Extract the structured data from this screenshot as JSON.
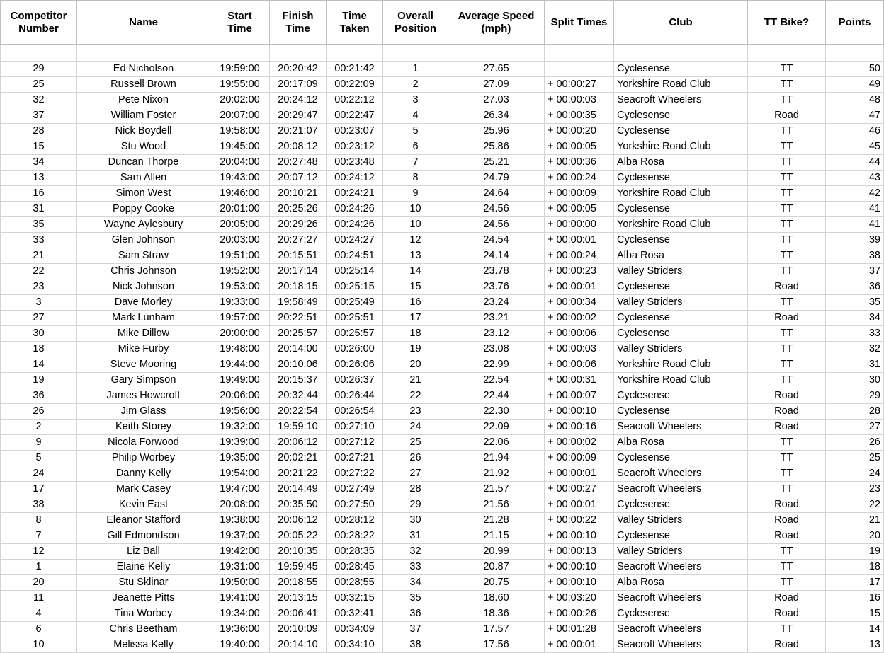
{
  "table": {
    "columns": [
      {
        "key": "number",
        "label": "Competitor Number"
      },
      {
        "key": "name",
        "label": "Name"
      },
      {
        "key": "start",
        "label": "Start Time"
      },
      {
        "key": "finish",
        "label": "Finish Time"
      },
      {
        "key": "taken",
        "label": "Time Taken"
      },
      {
        "key": "pos",
        "label": "Overall Position"
      },
      {
        "key": "speed",
        "label": "Average Speed (mph)"
      },
      {
        "key": "split",
        "label": "Split Times"
      },
      {
        "key": "club",
        "label": "Club"
      },
      {
        "key": "bike",
        "label": "TT Bike?"
      },
      {
        "key": "points",
        "label": "Points"
      }
    ],
    "header_lines": {
      "number": [
        "Competitor",
        "Number"
      ],
      "name": [
        "Name"
      ],
      "start": [
        "Start",
        "Time"
      ],
      "finish": [
        "Finish",
        "Time"
      ],
      "taken": [
        "Time",
        "Taken"
      ],
      "pos": [
        "Overall",
        "Position"
      ],
      "speed": [
        "Average Speed",
        "(mph)"
      ],
      "split": [
        "Split Times"
      ],
      "club": [
        "Club"
      ],
      "bike": [
        "TT Bike?"
      ],
      "points": [
        "Points"
      ]
    },
    "rows": [
      {
        "number": "29",
        "name": "Ed Nicholson",
        "start": "19:59:00",
        "finish": "20:20:42",
        "taken": "00:21:42",
        "pos": "1",
        "speed": "27.65",
        "split": "",
        "club": "Cyclesense",
        "bike": "TT",
        "points": "50"
      },
      {
        "number": "25",
        "name": "Russell Brown",
        "start": "19:55:00",
        "finish": "20:17:09",
        "taken": "00:22:09",
        "pos": "2",
        "speed": "27.09",
        "split": "+ 00:00:27",
        "club": "Yorkshire Road Club",
        "bike": "TT",
        "points": "49"
      },
      {
        "number": "32",
        "name": "Pete Nixon",
        "start": "20:02:00",
        "finish": "20:24:12",
        "taken": "00:22:12",
        "pos": "3",
        "speed": "27.03",
        "split": "+ 00:00:03",
        "club": "Seacroft Wheelers",
        "bike": "TT",
        "points": "48"
      },
      {
        "number": "37",
        "name": "William Foster",
        "start": "20:07:00",
        "finish": "20:29:47",
        "taken": "00:22:47",
        "pos": "4",
        "speed": "26.34",
        "split": "+ 00:00:35",
        "club": "Cyclesense",
        "bike": "Road",
        "points": "47"
      },
      {
        "number": "28",
        "name": "Nick Boydell",
        "start": "19:58:00",
        "finish": "20:21:07",
        "taken": "00:23:07",
        "pos": "5",
        "speed": "25.96",
        "split": "+ 00:00:20",
        "club": "Cyclesense",
        "bike": "TT",
        "points": "46"
      },
      {
        "number": "15",
        "name": "Stu Wood",
        "start": "19:45:00",
        "finish": "20:08:12",
        "taken": "00:23:12",
        "pos": "6",
        "speed": "25.86",
        "split": "+ 00:00:05",
        "club": "Yorkshire Road Club",
        "bike": "TT",
        "points": "45"
      },
      {
        "number": "34",
        "name": "Duncan Thorpe",
        "start": "20:04:00",
        "finish": "20:27:48",
        "taken": "00:23:48",
        "pos": "7",
        "speed": "25.21",
        "split": "+ 00:00:36",
        "club": "Alba Rosa",
        "bike": "TT",
        "points": "44"
      },
      {
        "number": "13",
        "name": "Sam Allen",
        "start": "19:43:00",
        "finish": "20:07:12",
        "taken": "00:24:12",
        "pos": "8",
        "speed": "24.79",
        "split": "+ 00:00:24",
        "club": "Cyclesense",
        "bike": "TT",
        "points": "43"
      },
      {
        "number": "16",
        "name": "Simon West",
        "start": "19:46:00",
        "finish": "20:10:21",
        "taken": "00:24:21",
        "pos": "9",
        "speed": "24.64",
        "split": "+ 00:00:09",
        "club": "Yorkshire Road Club",
        "bike": "TT",
        "points": "42"
      },
      {
        "number": "31",
        "name": "Poppy Cooke",
        "start": "20:01:00",
        "finish": "20:25:26",
        "taken": "00:24:26",
        "pos": "10",
        "speed": "24.56",
        "split": "+ 00:00:05",
        "club": "Cyclesense",
        "bike": "TT",
        "points": "41"
      },
      {
        "number": "35",
        "name": "Wayne Aylesbury",
        "start": "20:05:00",
        "finish": "20:29:26",
        "taken": "00:24:26",
        "pos": "10",
        "speed": "24.56",
        "split": "+ 00:00:00",
        "club": "Yorkshire Road Club",
        "bike": "TT",
        "points": "41"
      },
      {
        "number": "33",
        "name": "Glen Johnson",
        "start": "20:03:00",
        "finish": "20:27:27",
        "taken": "00:24:27",
        "pos": "12",
        "speed": "24.54",
        "split": "+ 00:00:01",
        "club": "Cyclesense",
        "bike": "TT",
        "points": "39"
      },
      {
        "number": "21",
        "name": "Sam Straw",
        "start": "19:51:00",
        "finish": "20:15:51",
        "taken": "00:24:51",
        "pos": "13",
        "speed": "24.14",
        "split": "+ 00:00:24",
        "club": "Alba Rosa",
        "bike": "TT",
        "points": "38"
      },
      {
        "number": "22",
        "name": "Chris Johnson",
        "start": "19:52:00",
        "finish": "20:17:14",
        "taken": "00:25:14",
        "pos": "14",
        "speed": "23.78",
        "split": "+ 00:00:23",
        "club": "Valley Striders",
        "bike": "TT",
        "points": "37"
      },
      {
        "number": "23",
        "name": "Nick Johnson",
        "start": "19:53:00",
        "finish": "20:18:15",
        "taken": "00:25:15",
        "pos": "15",
        "speed": "23.76",
        "split": "+ 00:00:01",
        "club": "Cyclesense",
        "bike": "Road",
        "points": "36"
      },
      {
        "number": "3",
        "name": "Dave Morley",
        "start": "19:33:00",
        "finish": "19:58:49",
        "taken": "00:25:49",
        "pos": "16",
        "speed": "23.24",
        "split": "+ 00:00:34",
        "club": "Valley Striders",
        "bike": "TT",
        "points": "35"
      },
      {
        "number": "27",
        "name": "Mark Lunham",
        "start": "19:57:00",
        "finish": "20:22:51",
        "taken": "00:25:51",
        "pos": "17",
        "speed": "23.21",
        "split": "+ 00:00:02",
        "club": "Cyclesense",
        "bike": "Road",
        "points": "34"
      },
      {
        "number": "30",
        "name": "Mike Dillow",
        "start": "20:00:00",
        "finish": "20:25:57",
        "taken": "00:25:57",
        "pos": "18",
        "speed": "23.12",
        "split": "+ 00:00:06",
        "club": "Cyclesense",
        "bike": "TT",
        "points": "33"
      },
      {
        "number": "18",
        "name": "Mike Furby",
        "start": "19:48:00",
        "finish": "20:14:00",
        "taken": "00:26:00",
        "pos": "19",
        "speed": "23.08",
        "split": "+ 00:00:03",
        "club": "Valley Striders",
        "bike": "TT",
        "points": "32"
      },
      {
        "number": "14",
        "name": "Steve Mooring",
        "start": "19:44:00",
        "finish": "20:10:06",
        "taken": "00:26:06",
        "pos": "20",
        "speed": "22.99",
        "split": "+ 00:00:06",
        "club": "Yorkshire Road Club",
        "bike": "TT",
        "points": "31"
      },
      {
        "number": "19",
        "name": "Gary Simpson",
        "start": "19:49:00",
        "finish": "20:15:37",
        "taken": "00:26:37",
        "pos": "21",
        "speed": "22.54",
        "split": "+ 00:00:31",
        "club": "Yorkshire Road Club",
        "bike": "TT",
        "points": "30"
      },
      {
        "number": "36",
        "name": "James Howcroft",
        "start": "20:06:00",
        "finish": "20:32:44",
        "taken": "00:26:44",
        "pos": "22",
        "speed": "22.44",
        "split": "+ 00:00:07",
        "club": "Cyclesense",
        "bike": "Road",
        "points": "29"
      },
      {
        "number": "26",
        "name": "Jim Glass",
        "start": "19:56:00",
        "finish": "20:22:54",
        "taken": "00:26:54",
        "pos": "23",
        "speed": "22.30",
        "split": "+ 00:00:10",
        "club": "Cyclesense",
        "bike": "Road",
        "points": "28"
      },
      {
        "number": "2",
        "name": "Keith Storey",
        "start": "19:32:00",
        "finish": "19:59:10",
        "taken": "00:27:10",
        "pos": "24",
        "speed": "22.09",
        "split": "+ 00:00:16",
        "club": "Seacroft Wheelers",
        "bike": "Road",
        "points": "27"
      },
      {
        "number": "9",
        "name": "Nicola Forwood",
        "start": "19:39:00",
        "finish": "20:06:12",
        "taken": "00:27:12",
        "pos": "25",
        "speed": "22.06",
        "split": "+ 00:00:02",
        "club": "Alba Rosa",
        "bike": "TT",
        "points": "26"
      },
      {
        "number": "5",
        "name": "Philip Worbey",
        "start": "19:35:00",
        "finish": "20:02:21",
        "taken": "00:27:21",
        "pos": "26",
        "speed": "21.94",
        "split": "+ 00:00:09",
        "club": "Cyclesense",
        "bike": "TT",
        "points": "25"
      },
      {
        "number": "24",
        "name": "Danny Kelly",
        "start": "19:54:00",
        "finish": "20:21:22",
        "taken": "00:27:22",
        "pos": "27",
        "speed": "21.92",
        "split": "+ 00:00:01",
        "club": "Seacroft Wheelers",
        "bike": "TT",
        "points": "24"
      },
      {
        "number": "17",
        "name": "Mark Casey",
        "start": "19:47:00",
        "finish": "20:14:49",
        "taken": "00:27:49",
        "pos": "28",
        "speed": "21.57",
        "split": "+ 00:00:27",
        "club": "Seacroft Wheelers",
        "bike": "TT",
        "points": "23"
      },
      {
        "number": "38",
        "name": "Kevin East",
        "start": "20:08:00",
        "finish": "20:35:50",
        "taken": "00:27:50",
        "pos": "29",
        "speed": "21.56",
        "split": "+ 00:00:01",
        "club": "Cyclesense",
        "bike": "Road",
        "points": "22"
      },
      {
        "number": "8",
        "name": "Eleanor Stafford",
        "start": "19:38:00",
        "finish": "20:06:12",
        "taken": "00:28:12",
        "pos": "30",
        "speed": "21.28",
        "split": "+ 00:00:22",
        "club": "Valley Striders",
        "bike": "Road",
        "points": "21"
      },
      {
        "number": "7",
        "name": "Gill Edmondson",
        "start": "19:37:00",
        "finish": "20:05:22",
        "taken": "00:28:22",
        "pos": "31",
        "speed": "21.15",
        "split": "+ 00:00:10",
        "club": "Cyclesense",
        "bike": "Road",
        "points": "20"
      },
      {
        "number": "12",
        "name": "Liz Ball",
        "start": "19:42:00",
        "finish": "20:10:35",
        "taken": "00:28:35",
        "pos": "32",
        "speed": "20.99",
        "split": "+ 00:00:13",
        "club": "Valley Striders",
        "bike": "TT",
        "points": "19"
      },
      {
        "number": "1",
        "name": "Elaine Kelly",
        "start": "19:31:00",
        "finish": "19:59:45",
        "taken": "00:28:45",
        "pos": "33",
        "speed": "20.87",
        "split": "+ 00:00:10",
        "club": "Seacroft Wheelers",
        "bike": "TT",
        "points": "18"
      },
      {
        "number": "20",
        "name": "Stu Sklinar",
        "start": "19:50:00",
        "finish": "20:18:55",
        "taken": "00:28:55",
        "pos": "34",
        "speed": "20.75",
        "split": "+ 00:00:10",
        "club": "Alba Rosa",
        "bike": "TT",
        "points": "17"
      },
      {
        "number": "11",
        "name": "Jeanette Pitts",
        "start": "19:41:00",
        "finish": "20:13:15",
        "taken": "00:32:15",
        "pos": "35",
        "speed": "18.60",
        "split": "+ 00:03:20",
        "club": "Seacroft Wheelers",
        "bike": "Road",
        "points": "16"
      },
      {
        "number": "4",
        "name": "Tina Worbey",
        "start": "19:34:00",
        "finish": "20:06:41",
        "taken": "00:32:41",
        "pos": "36",
        "speed": "18.36",
        "split": "+ 00:00:26",
        "club": "Cyclesense",
        "bike": "Road",
        "points": "15"
      },
      {
        "number": "6",
        "name": "Chris Beetham",
        "start": "19:36:00",
        "finish": "20:10:09",
        "taken": "00:34:09",
        "pos": "37",
        "speed": "17.57",
        "split": "+ 00:01:28",
        "club": "Seacroft Wheelers",
        "bike": "TT",
        "points": "14"
      },
      {
        "number": "10",
        "name": "Melissa Kelly",
        "start": "19:40:00",
        "finish": "20:14:10",
        "taken": "00:34:10",
        "pos": "38",
        "speed": "17.56",
        "split": "+ 00:00:01",
        "club": "Seacroft Wheelers",
        "bike": "Road",
        "points": "13"
      }
    ]
  },
  "colors": {
    "grid": "#d4d4d4",
    "header_grid": "#bfbfbf",
    "text": "#000000",
    "background": "#ffffff"
  }
}
